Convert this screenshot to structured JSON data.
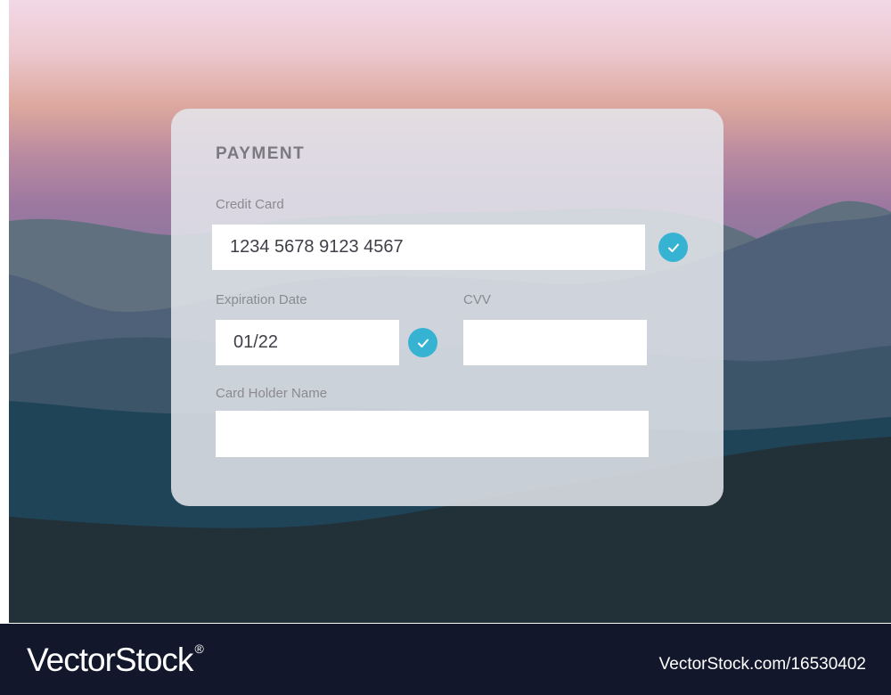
{
  "watermark": {
    "brand": "VectorStock",
    "registered_mark": "®",
    "image_id": "VectorStock.com/16530402"
  },
  "form": {
    "title": "PAYMENT",
    "credit_card": {
      "label": "Credit Card",
      "value": "1234 5678 9123 4567",
      "validated": true
    },
    "expiration": {
      "label": "Expiration Date",
      "value": "01/22",
      "validated": true
    },
    "cvv": {
      "label": "CVV",
      "value": ""
    },
    "holder": {
      "label": "Card Holder Name",
      "value": ""
    }
  },
  "colors": {
    "check": "#36b3d3",
    "footer": "#13172b",
    "card": "rgba(228,230,236,0.86)"
  },
  "icons": {
    "valid": "check-circle-icon"
  }
}
